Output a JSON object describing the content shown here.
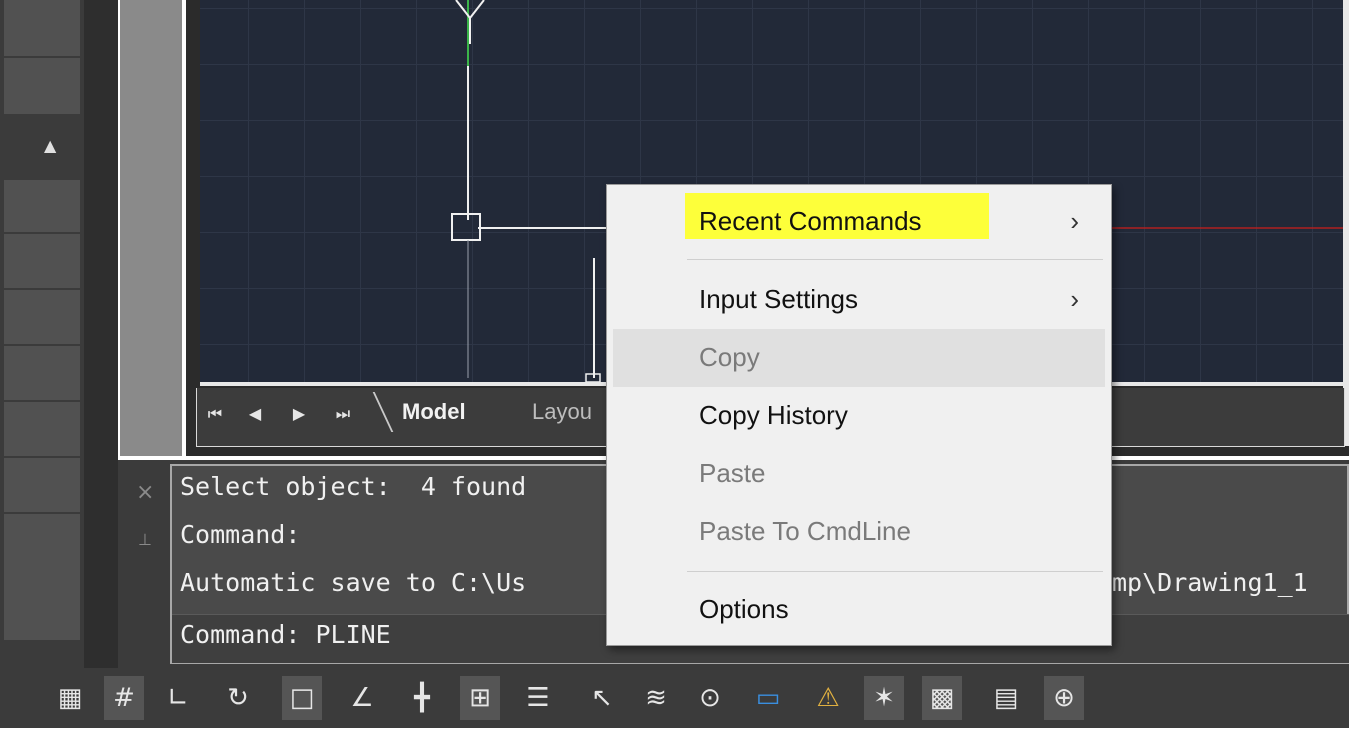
{
  "viewport": {
    "nav_first": "⏮",
    "nav_prev": "◀",
    "nav_next": "▶",
    "nav_last": "⏭",
    "tabs": {
      "model": "Model",
      "layout": "Layou"
    }
  },
  "palette": {
    "collapse_glyph": "▲"
  },
  "command_line": {
    "close_glyph": "×",
    "pin_glyph": "⊥",
    "history": [
      "Select object:  4 found",
      "Command:",
      "Automatic save to C:\\Us"
    ],
    "history_tail": "mp\\Drawing1_1",
    "current": "Command: PLINE"
  },
  "context_menu": {
    "items": [
      {
        "label": "Recent Commands",
        "submenu": true,
        "enabled": true,
        "highlighted": true
      },
      {
        "label": "Input Settings",
        "submenu": true,
        "enabled": true
      },
      {
        "label": "Copy",
        "submenu": false,
        "enabled": false,
        "hovered": true
      },
      {
        "label": "Copy History",
        "submenu": false,
        "enabled": true
      },
      {
        "label": "Paste",
        "submenu": false,
        "enabled": false
      },
      {
        "label": "Paste To CmdLine",
        "submenu": false,
        "enabled": false
      },
      {
        "label": "Options",
        "submenu": false,
        "enabled": true
      }
    ],
    "submenu_glyph": "›",
    "highlight_color": "#fdff3a"
  },
  "status_bar": {
    "icons": [
      {
        "name": "model-space-grid-icon",
        "glyph": "▦"
      },
      {
        "name": "grid-display-icon",
        "glyph": "#"
      },
      {
        "name": "snap-mode-icon",
        "glyph": "∟"
      },
      {
        "name": "polar-tracking-icon",
        "glyph": "↻"
      },
      {
        "name": "object-snap-icon",
        "glyph": "□"
      },
      {
        "name": "isometric-drafting-icon",
        "glyph": "∠"
      },
      {
        "name": "object-snap-tracking-icon",
        "glyph": "╋"
      },
      {
        "name": "dynamic-input-icon",
        "glyph": "⊞"
      },
      {
        "name": "lineweight-icon",
        "glyph": "☰"
      },
      {
        "name": "selection-cycling-icon",
        "glyph": "↖"
      },
      {
        "name": "layers-icon",
        "glyph": "≋"
      },
      {
        "name": "zoom-icon",
        "glyph": "⊙"
      },
      {
        "name": "viewport-icon",
        "glyph": "▭"
      },
      {
        "name": "annotation-visibility-icon",
        "glyph": "⚠"
      },
      {
        "name": "auto-scale-icon",
        "glyph": "✶"
      },
      {
        "name": "hardware-acceleration-icon",
        "glyph": "▩"
      },
      {
        "name": "properties-icon",
        "glyph": "▤"
      },
      {
        "name": "customize-icon",
        "glyph": "⊕"
      }
    ]
  },
  "colors": {
    "canvas_background": "#222938",
    "ucs_y_axis": "#3bb54a",
    "x_axis_line": "#b02020"
  }
}
